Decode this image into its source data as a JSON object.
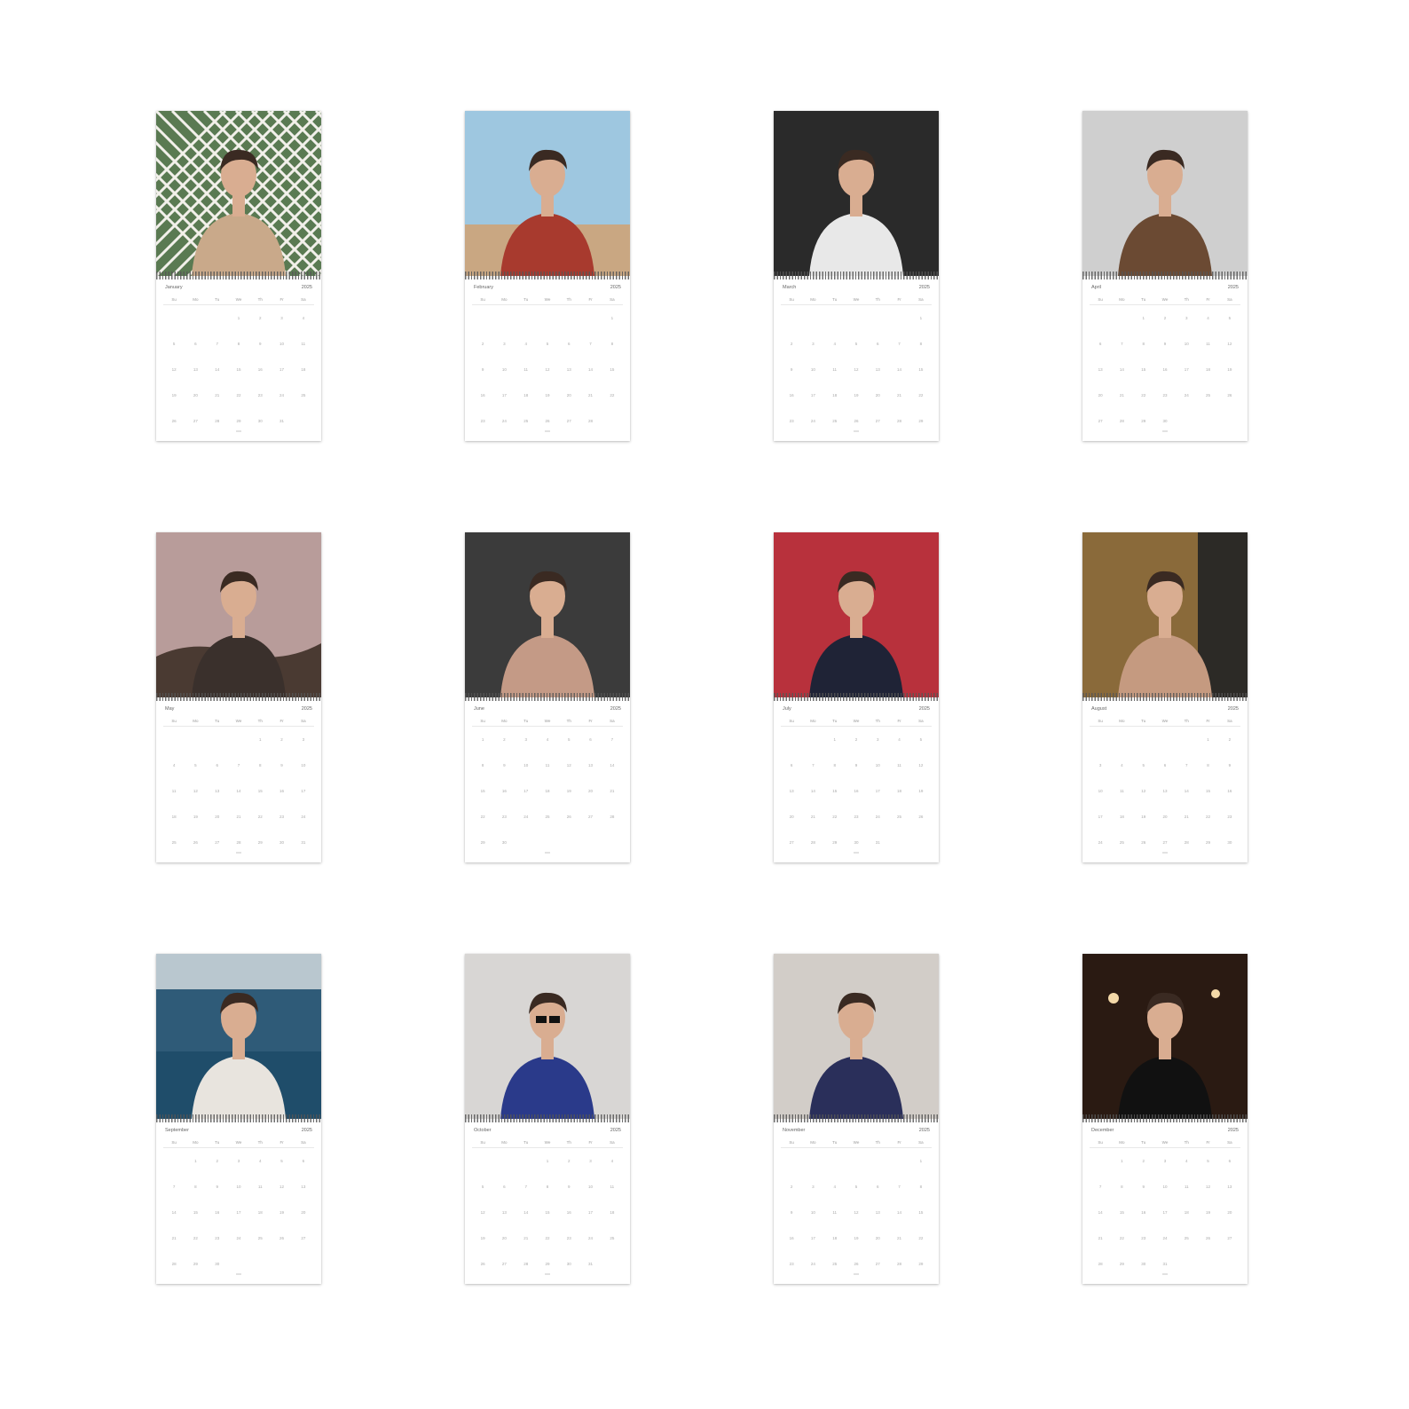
{
  "calendar": {
    "year": "2025",
    "weekdays": [
      "Su",
      "Mo",
      "Tu",
      "We",
      "Th",
      "Fr",
      "Sa"
    ],
    "months": [
      {
        "name": "January",
        "start": 3,
        "days": 31,
        "photo": {
          "bg": "#5a7a52",
          "accent": "#c9a98a",
          "style": "lattice"
        }
      },
      {
        "name": "February",
        "start": 6,
        "days": 28,
        "photo": {
          "bg": "#9ec7e0",
          "accent": "#a83a2e",
          "style": "sky"
        }
      },
      {
        "name": "March",
        "start": 6,
        "days": 31,
        "photo": {
          "bg": "#2a2a2a",
          "accent": "#e8e8e8",
          "style": "bw"
        }
      },
      {
        "name": "April",
        "start": 2,
        "days": 30,
        "photo": {
          "bg": "#cfcfcf",
          "accent": "#6b4a33",
          "style": "studio"
        }
      },
      {
        "name": "May",
        "start": 4,
        "days": 31,
        "photo": {
          "bg": "#b89c9a",
          "accent": "#3a302c",
          "style": "dusk"
        }
      },
      {
        "name": "June",
        "start": 0,
        "days": 30,
        "photo": {
          "bg": "#3b3b3b",
          "accent": "#c49a86",
          "style": "portrait"
        }
      },
      {
        "name": "July",
        "start": 2,
        "days": 31,
        "photo": {
          "bg": "#b8313c",
          "accent": "#1f2336",
          "style": "red"
        }
      },
      {
        "name": "August",
        "start": 5,
        "days": 31,
        "photo": {
          "bg": "#8a6a3a",
          "accent": "#c59a80",
          "style": "warm"
        }
      },
      {
        "name": "September",
        "start": 1,
        "days": 30,
        "photo": {
          "bg": "#2f5b78",
          "accent": "#e8e4de",
          "style": "pool"
        }
      },
      {
        "name": "October",
        "start": 3,
        "days": 31,
        "photo": {
          "bg": "#d8d6d4",
          "accent": "#2a3a8a",
          "style": "glasses"
        }
      },
      {
        "name": "November",
        "start": 6,
        "days": 30,
        "photo": {
          "bg": "#d2cdc8",
          "accent": "#2a2f5a",
          "style": "sweater"
        }
      },
      {
        "name": "December",
        "start": 1,
        "days": 31,
        "photo": {
          "bg": "#2a1a12",
          "accent": "#111111",
          "style": "tux"
        }
      }
    ]
  }
}
